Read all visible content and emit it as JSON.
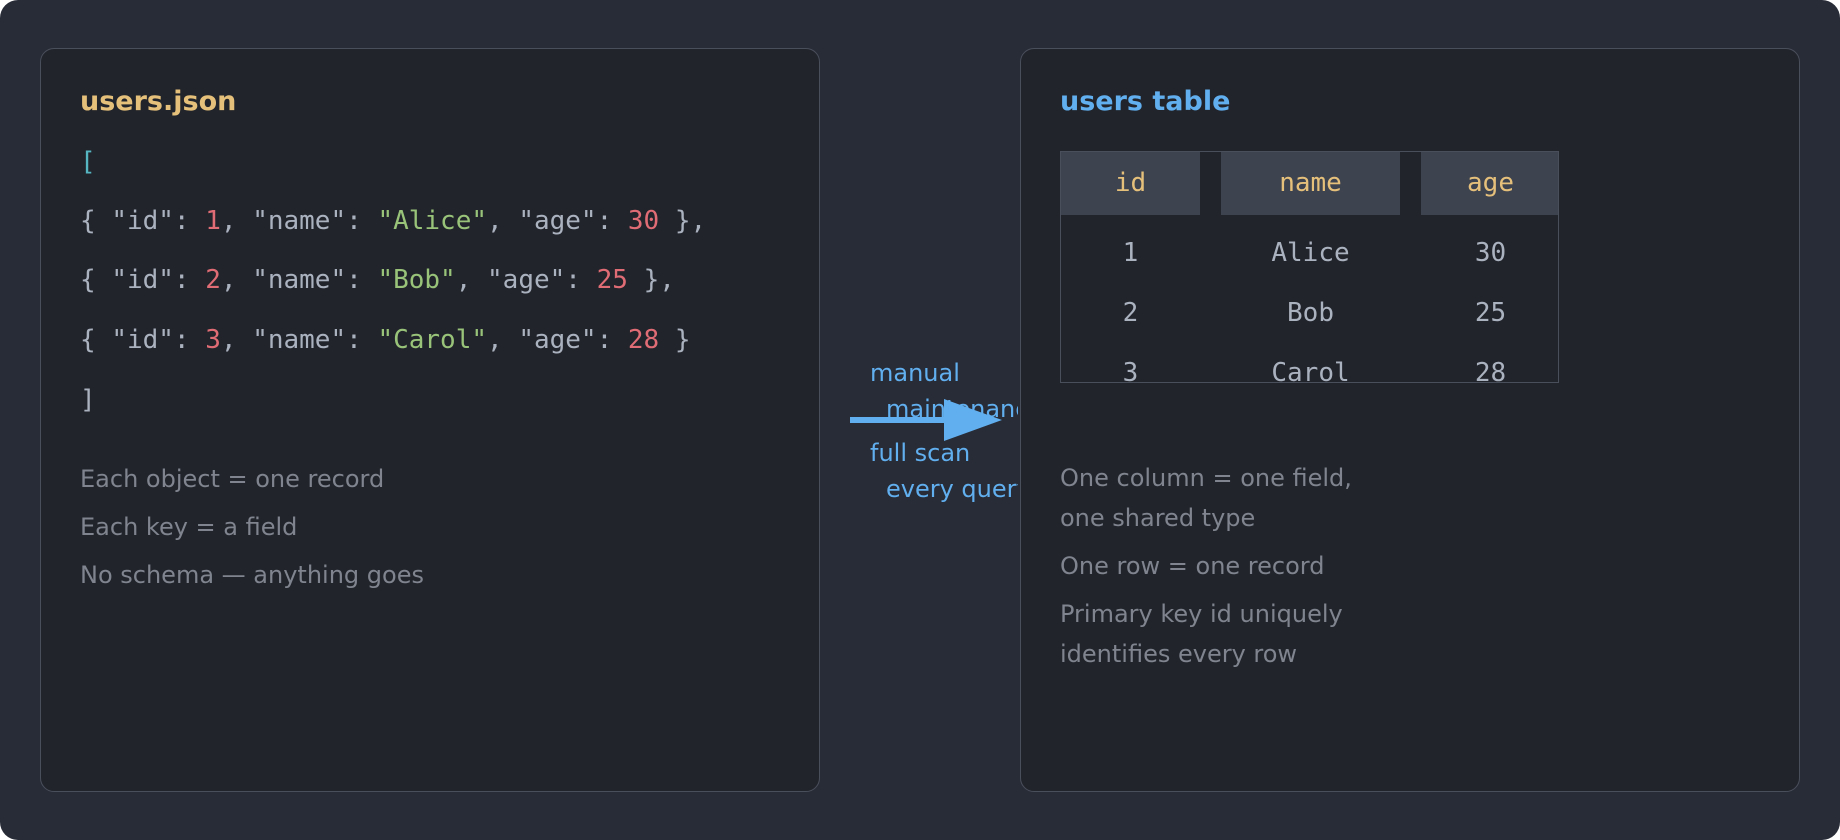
{
  "left_panel": {
    "title": "users.json",
    "code": {
      "open_bracket": "[",
      "close_bracket": "]",
      "rows": [
        {
          "id": "1",
          "name": "\"Alice\"",
          "age": "30",
          "trail": " },"
        },
        {
          "id": "2",
          "name": "\"Bob\"",
          "age": "25",
          "trail": " },"
        },
        {
          "id": "3",
          "name": "\"Carol\"",
          "age": "28",
          "trail": " }"
        }
      ],
      "tokens": {
        "open_brace": "{ ",
        "id_key": "\"id\": ",
        "name_key": ", \"name\": ",
        "age_key": ", \"age\": "
      }
    },
    "notes": [
      "Each object = one record",
      "Each key = a field",
      "No schema — anything goes"
    ]
  },
  "arrow": {
    "label_top_line1": "manual",
    "label_top_line2": "maintenance",
    "label_bottom_line1": "full scan",
    "label_bottom_line2": "every query"
  },
  "right_panel": {
    "title": "users table",
    "table": {
      "columns": [
        "id",
        "name",
        "age"
      ],
      "rows": [
        [
          "1",
          "Alice",
          "30"
        ],
        [
          "2",
          "Bob",
          "25"
        ],
        [
          "3",
          "Carol",
          "28"
        ]
      ]
    },
    "notes": [
      "One column = one field,",
      "one shared type",
      "One row = one record",
      "Primary key id uniquely",
      "identifies every row"
    ]
  },
  "colors": {
    "background": "#282c36",
    "panel": "#21242b",
    "border": "#4a4f5c",
    "json_title": "#e5c07b",
    "table_title": "#61afef",
    "number": "#e06c75",
    "string": "#98c379",
    "arrow": "#61afef",
    "note": "#7f848e"
  }
}
